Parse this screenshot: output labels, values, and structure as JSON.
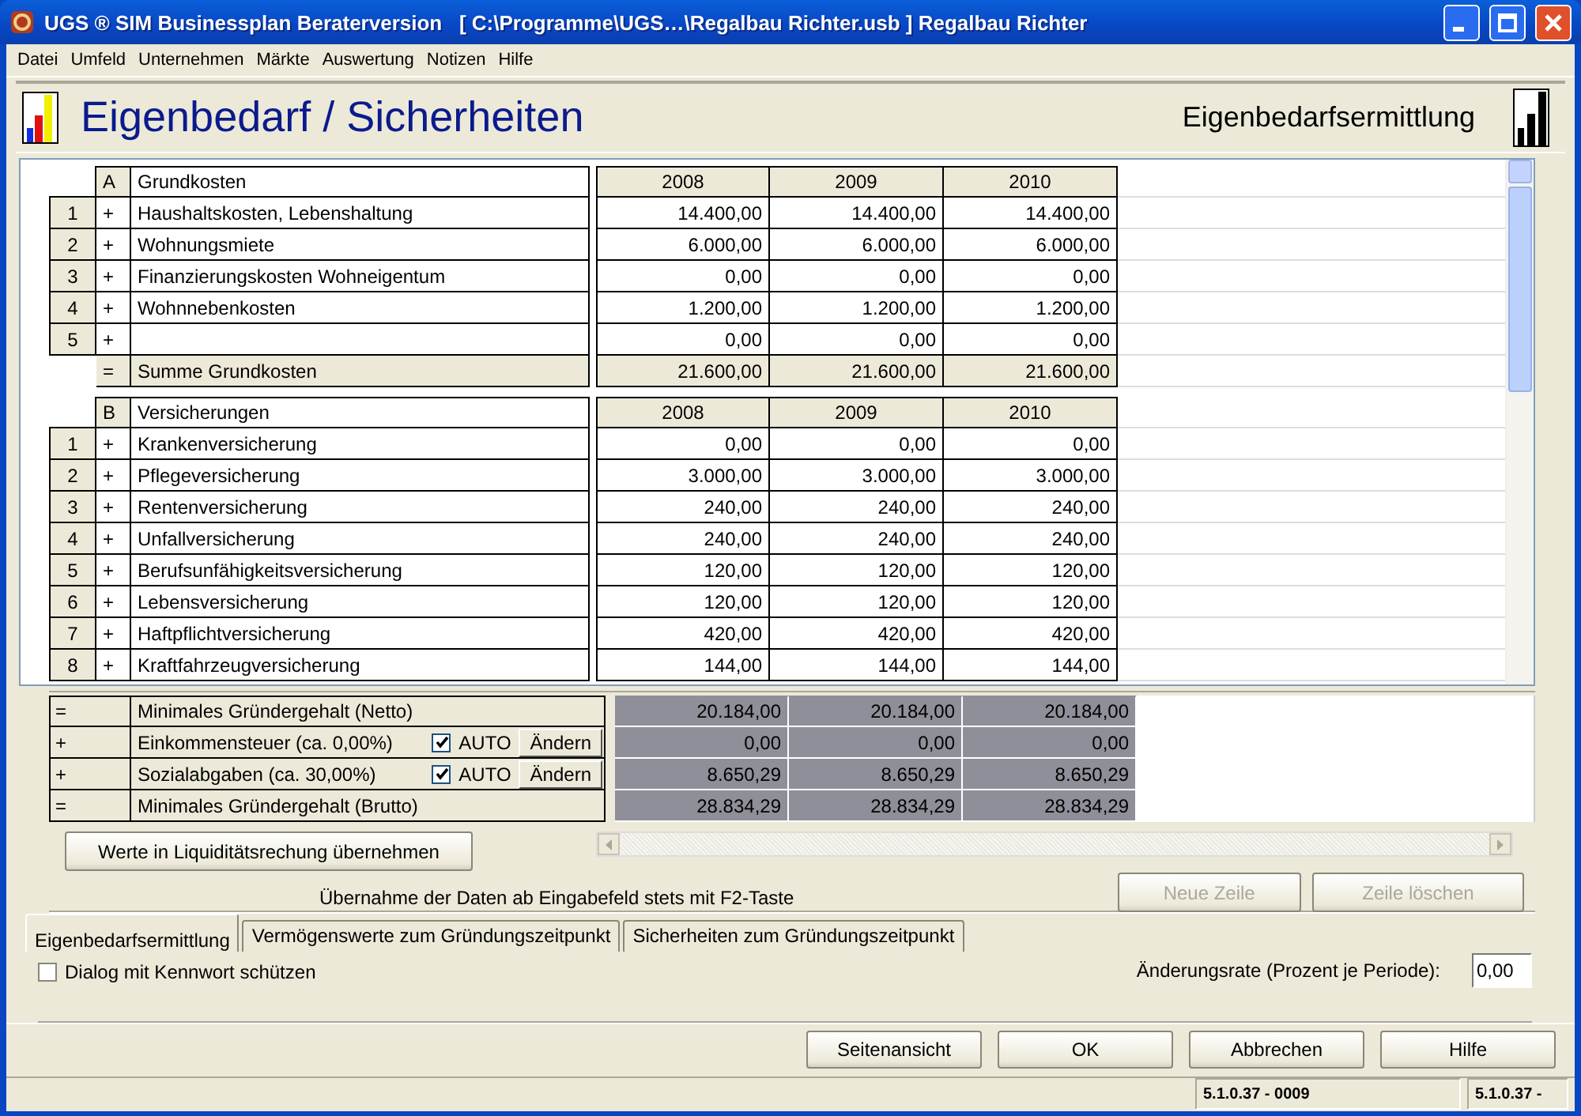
{
  "window": {
    "title": "UGS ® SIM Businessplan Beraterversion   [ C:\\Programme\\UGS…\\Regalbau Richter.usb ] Regalbau Richter"
  },
  "menu": [
    "Datei",
    "Umfeld",
    "Unternehmen",
    "Märkte",
    "Auswertung",
    "Notizen",
    "Hilfe"
  ],
  "header": {
    "title": "Eigenbedarf / Sicherheiten",
    "subtitle": "Eigenbedarfsermittlung"
  },
  "sections": [
    {
      "letter": "A",
      "title": "Grundkosten",
      "years": [
        "2008",
        "2009",
        "2010"
      ],
      "rows": [
        {
          "number": "1",
          "sign": "+",
          "label": "Haushaltskosten, Lebenshaltung",
          "values": [
            "14.400,00",
            "14.400,00",
            "14.400,00"
          ]
        },
        {
          "number": "2",
          "sign": "+",
          "label": "Wohnungsmiete",
          "values": [
            "6.000,00",
            "6.000,00",
            "6.000,00"
          ]
        },
        {
          "number": "3",
          "sign": "+",
          "label": "Finanzierungskosten Wohneigentum",
          "values": [
            "0,00",
            "0,00",
            "0,00"
          ]
        },
        {
          "number": "4",
          "sign": "+",
          "label": "Wohnnebenkosten",
          "values": [
            "1.200,00",
            "1.200,00",
            "1.200,00"
          ]
        },
        {
          "number": "5",
          "sign": "+",
          "values": [
            "0,00",
            "0,00",
            "0,00"
          ]
        }
      ],
      "total": {
        "sign": "=",
        "label": "Summe Grundkosten",
        "values": [
          "21.600,00",
          "21.600,00",
          "21.600,00"
        ]
      }
    },
    {
      "letter": "B",
      "title": "Versicherungen",
      "years": [
        "2008",
        "2009",
        "2010"
      ],
      "rows": [
        {
          "number": "1",
          "sign": "+",
          "label": "Krankenversicherung",
          "values": [
            "0,00",
            "0,00",
            "0,00"
          ]
        },
        {
          "number": "2",
          "sign": "+",
          "label": "Pflegeversicherung",
          "values": [
            "3.000,00",
            "3.000,00",
            "3.000,00"
          ]
        },
        {
          "number": "3",
          "sign": "+",
          "label": "Rentenversicherung",
          "values": [
            "240,00",
            "240,00",
            "240,00"
          ]
        },
        {
          "number": "4",
          "sign": "+",
          "label": "Unfallversicherung",
          "values": [
            "240,00",
            "240,00",
            "240,00"
          ]
        },
        {
          "number": "5",
          "sign": "+",
          "label": "Berufsunfähigkeitsversicherung",
          "values": [
            "120,00",
            "120,00",
            "120,00"
          ]
        },
        {
          "number": "6",
          "sign": "+",
          "label": "Lebensversicherung",
          "values": [
            "120,00",
            "120,00",
            "120,00"
          ]
        },
        {
          "number": "7",
          "sign": "+",
          "label": "Haftpflichtversicherung",
          "values": [
            "420,00",
            "420,00",
            "420,00"
          ]
        },
        {
          "number": "8",
          "sign": "+",
          "label": "Kraftfahrzeugversicherung",
          "values": [
            "144,00",
            "144,00",
            "144,00"
          ]
        }
      ]
    }
  ],
  "summary": [
    {
      "kind": "plain",
      "sign": "=",
      "label": "Minimales Gründergehalt (Netto)",
      "values": [
        "20.184,00",
        "20.184,00",
        "20.184,00"
      ]
    },
    {
      "kind": "auto",
      "sign": "+",
      "label": "Einkommensteuer (ca. 0,00%)",
      "auto_checked": true,
      "auto_label": "AUTO",
      "button": "Ändern",
      "values": [
        "0,00",
        "0,00",
        "0,00"
      ]
    },
    {
      "kind": "auto",
      "sign": "+",
      "label": "Sozialabgaben (ca. 30,00%)",
      "auto_checked": true,
      "auto_label": "AUTO",
      "button": "Ändern",
      "values": [
        "8.650,29",
        "8.650,29",
        "8.650,29"
      ]
    },
    {
      "kind": "plain",
      "sign": "=",
      "label": "Minimales Gründergehalt (Brutto)",
      "values": [
        "28.834,29",
        "28.834,29",
        "28.834,29"
      ]
    }
  ],
  "transfer_button": "Werte in Liquiditätsrechung übernehmen",
  "hint": "Übernahme der Daten ab Eingabefeld stets mit F2-Taste",
  "row_buttons": [
    {
      "label": "Neue Zeile",
      "disabled": true
    },
    {
      "label": "Zeile löschen",
      "disabled": true
    }
  ],
  "tabs": [
    {
      "label": "Eigenbedarfsermittlung",
      "selected": true
    },
    {
      "label": "Vermögenswerte zum Gründungszeitpunkt",
      "selected": false
    },
    {
      "label": "Sicherheiten zum Gründungszeitpunkt",
      "selected": false
    }
  ],
  "password_checkbox": {
    "label": "Dialog mit Kennwort schützen",
    "checked": false
  },
  "rate": {
    "label": "Änderungsrate (Prozent je Periode):",
    "value": "0,00"
  },
  "buttons": [
    "Seitenansicht",
    "OK",
    "Abbrechen",
    "Hilfe"
  ],
  "status_bar": [
    "5.1.0.37 - 0009",
    "5.1.0.37 -"
  ]
}
